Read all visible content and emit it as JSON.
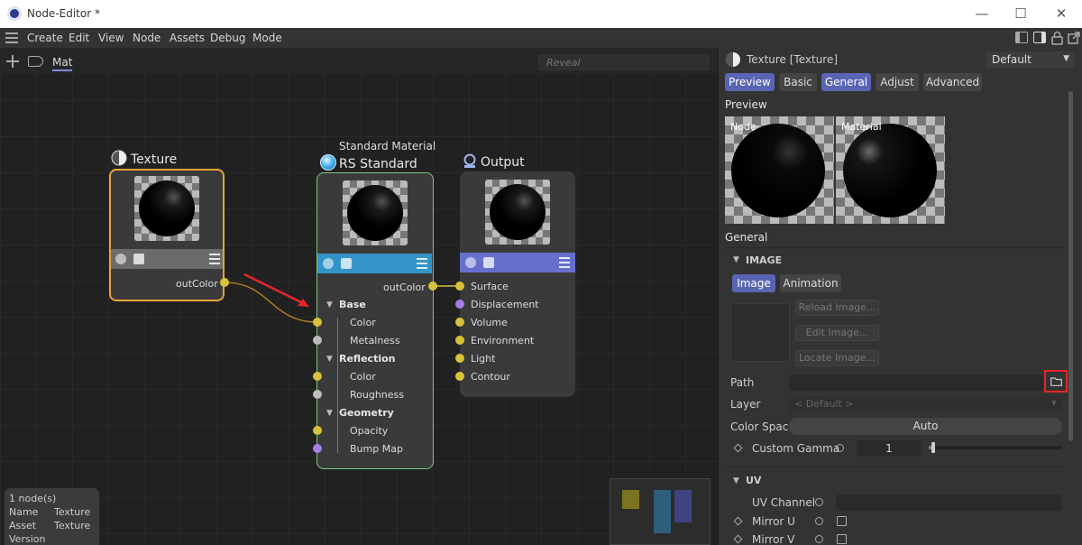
{
  "window": {
    "title": "Node-Editor *",
    "controls": [
      "—",
      "☐",
      "✕"
    ]
  },
  "menu": [
    "Create",
    "Edit",
    "View",
    "Node",
    "Assets",
    "Debug",
    "Mode"
  ],
  "graph": {
    "tab": "Mat",
    "reveal_placeholder": "Reveal",
    "texture_node": {
      "title": "Texture",
      "output": "outColor"
    },
    "standard_node": {
      "subtitle": "Standard Material",
      "title": "RS Standard",
      "output": "outColor",
      "groups": [
        {
          "label": "Base",
          "ports": [
            "Color",
            "Metalness"
          ]
        },
        {
          "label": "Reflection",
          "ports": [
            "Color",
            "Roughness"
          ]
        },
        {
          "label": "Geometry",
          "ports": [
            "Opacity",
            "Bump Map"
          ]
        }
      ]
    },
    "output_node": {
      "title": "Output",
      "inputs": [
        "Surface",
        "Displacement",
        "Volume",
        "Environment",
        "Light",
        "Contour"
      ]
    }
  },
  "info": {
    "count": "1 node(s)",
    "rows": [
      {
        "key": "Name",
        "value": "Texture"
      },
      {
        "key": "Asset",
        "value": "Texture"
      },
      {
        "key": "Version",
        "value": ""
      }
    ]
  },
  "panel": {
    "header_title": "Texture [Texture]",
    "preset": "Default",
    "tabs": [
      "Preview",
      "Basic",
      "General",
      "Adjust",
      "Advanced"
    ],
    "preview_section": "Preview",
    "preview_node_label": "Node",
    "preview_material_label": "Material",
    "general_section": "General",
    "image_section": "IMAGE",
    "image_tabs": [
      "Image",
      "Animation"
    ],
    "reload_image": "Reload Image...",
    "edit_image": "Edit Image...",
    "locate_image": "Locate Image...",
    "path_label": "Path",
    "path_value": "",
    "layer_label": "Layer",
    "layer_value": "< Default >",
    "color_space_label": "Color Space",
    "color_space_value": "Auto",
    "custom_gamma_label": "Custom Gamma",
    "custom_gamma_value": "1",
    "custom_gamma_slider": 0.02,
    "uv_section": "UV",
    "uv_channel_label": "UV Channel",
    "mirror_u_label": "Mirror U",
    "mirror_v_label": "Mirror V"
  },
  "colors": {
    "accent": "#5965b3",
    "texture_border": "#e6a33a",
    "standard_border": "#7bc87a",
    "standard_strip": "#3394c8",
    "output_strip": "#6670cc",
    "port_yellow": "#d8c23a",
    "port_purple": "#a97ce6",
    "highlight_red": "#e8242b"
  }
}
